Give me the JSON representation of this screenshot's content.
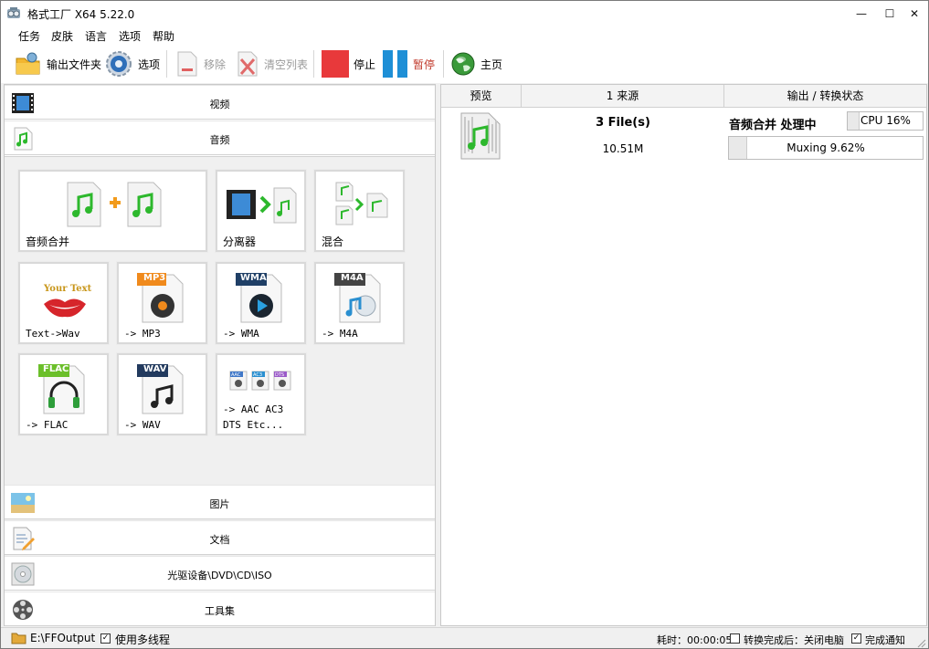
{
  "window": {
    "title": "格式工厂 X64 5.22.0",
    "minimize": "—",
    "maximize": "☐",
    "close": "✕"
  },
  "menu": [
    "任务",
    "皮肤",
    "语言",
    "选项",
    "帮助"
  ],
  "toolbar": {
    "output_folder": "输出文件夹",
    "options": "选项",
    "remove": "移除",
    "clear_list": "清空列表",
    "stop": "停止",
    "pause": "暂停",
    "home": "主页"
  },
  "categories": {
    "video": "视频",
    "audio": "音频",
    "picture": "图片",
    "document": "文档",
    "disc": "光驱设备\\DVD\\CD\\ISO",
    "tools": "工具集"
  },
  "tiles": {
    "audio_join": "音频合并",
    "splitter": "分离器",
    "mix": "混合",
    "text_wav": "Text->Wav",
    "mp3": "-> MP3",
    "wma": "-> WMA",
    "m4a": "-> M4A",
    "flac": "-> FLAC",
    "wav": "-> WAV",
    "aac_l1": "-> AAC AC3",
    "aac_l2": "DTS Etc..."
  },
  "tile_badges": {
    "mp3": "MP3",
    "wma": "WMA",
    "m4a": "M4A",
    "flac": "FLAC",
    "wav": "WAV",
    "your_text": "Your Text",
    "mini1": "AAC",
    "mini2": "AC3",
    "mini3": "DTS"
  },
  "task_table": {
    "headers": {
      "preview": "预览",
      "source": "1 来源",
      "output": "输出 / 转换状态"
    },
    "task": {
      "files": "3 File(s)",
      "size": "10.51M",
      "status": "音频合并 处理中",
      "cpu": "CPU 16%",
      "progress_text": "Muxing 9.62%",
      "progress": 0.0962
    }
  },
  "statusbar": {
    "output_path": "E:\\FFOutput",
    "multithread": "使用多线程",
    "elapsed": "耗时：00:00:05",
    "after_done": "转换完成后：关闭电脑",
    "notify": "完成通知"
  },
  "colors": {
    "stop": "#e8393b",
    "pause": "#1e8fd6",
    "green_note": "#2db82d",
    "progress_border": "#bcbcbc"
  }
}
